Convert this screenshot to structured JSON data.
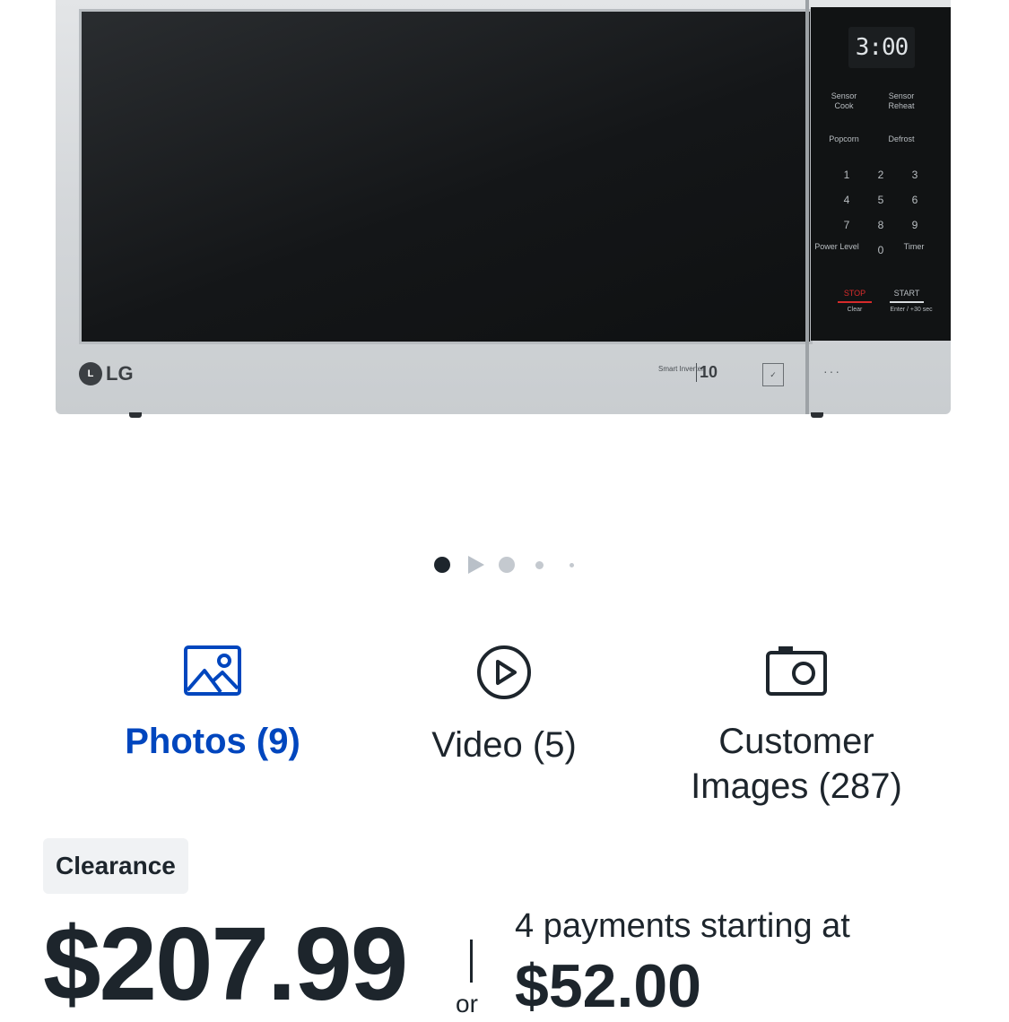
{
  "product_image": {
    "display_time": "3:00",
    "keys": {
      "sensor_cook": "Sensor Cook",
      "sensor_reheat": "Sensor Reheat",
      "popcorn": "Popcorn",
      "defrost": "Defrost",
      "power_level": "Power Level",
      "timer": "Timer",
      "stop": "STOP",
      "start": "START",
      "clear": "Clear",
      "enter": "Enter / +30 sec",
      "numbers": [
        "1",
        "2",
        "3",
        "4",
        "5",
        "6",
        "7",
        "8",
        "9",
        "0"
      ]
    },
    "brand": "LG",
    "badge_inverter": "Smart Inverter",
    "badge_years": "10"
  },
  "carousel": {
    "total_indicators": 5,
    "active_index": 0
  },
  "media_tabs": [
    {
      "label": "Photos (9)",
      "icon": "image-icon",
      "active": true
    },
    {
      "label": "Video (5)",
      "icon": "play-circle-icon",
      "active": false
    },
    {
      "label": "Customer Images (287)",
      "icon": "camera-icon",
      "active": false
    }
  ],
  "badge": {
    "label": "Clearance"
  },
  "pricing": {
    "price": "$207.99",
    "or_text": "or",
    "payments_text": "4 payments starting at",
    "payment_amount": "$52.00"
  },
  "colors": {
    "accent": "#0046be",
    "text": "#1d252c",
    "badge_bg": "#f0f2f4"
  }
}
